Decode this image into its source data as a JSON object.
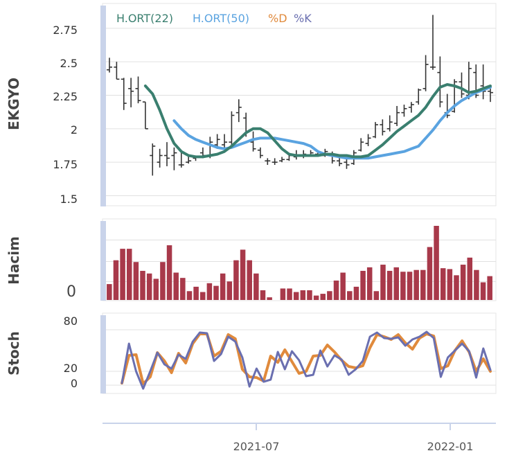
{
  "colors": {
    "ma22": "#3a7f6f",
    "ma50": "#5aa3e0",
    "stoch_d": "#e08a3c",
    "stoch_k": "#6a6fb0",
    "volume": "#a8394a",
    "ohlc": "#333333",
    "grid": "#e0e0e0",
    "scrollbar": "#c9d3ea"
  },
  "chart_data": [
    {
      "type": "ohlc",
      "ylabel": "EKGYO",
      "yticks": [
        "2.75",
        "2.5",
        "2.25",
        "2",
        "1.75",
        "1.5"
      ],
      "ylim": [
        1.43,
        2.92
      ],
      "x_ticks": [
        "2021-07",
        "2022-01"
      ],
      "legend": [
        "H.ORT(22)",
        "H.ORT(50)",
        "%D",
        "%K"
      ],
      "ohlc": [
        [
          2.44,
          2.53,
          2.42,
          2.46
        ],
        [
          2.46,
          2.5,
          2.37,
          2.37
        ],
        [
          2.37,
          2.38,
          2.14,
          2.19
        ],
        [
          2.3,
          2.38,
          2.16,
          2.28
        ],
        [
          2.3,
          2.39,
          2.19,
          2.21
        ],
        [
          2.2,
          2.2,
          2.0,
          2.0
        ],
        [
          1.8,
          1.89,
          1.65,
          1.87
        ],
        [
          1.75,
          1.85,
          1.71,
          1.8
        ],
        [
          1.8,
          1.9,
          1.72,
          1.78
        ],
        [
          1.8,
          1.86,
          1.69,
          1.82
        ],
        [
          1.73,
          1.82,
          1.71,
          1.73
        ],
        [
          1.75,
          1.8,
          1.74,
          1.76
        ],
        [
          1.78,
          1.8,
          1.76,
          1.79
        ],
        [
          1.82,
          1.86,
          1.78,
          1.8
        ],
        [
          1.8,
          1.94,
          1.78,
          1.9
        ],
        [
          1.88,
          1.96,
          1.85,
          1.92
        ],
        [
          1.88,
          1.96,
          1.85,
          1.9
        ],
        [
          1.9,
          2.13,
          1.88,
          2.1
        ],
        [
          2.12,
          2.22,
          2.05,
          2.16
        ],
        [
          2.08,
          2.12,
          1.94,
          1.98
        ],
        [
          1.9,
          1.98,
          1.83,
          1.85
        ],
        [
          1.84,
          1.86,
          1.78,
          1.8
        ],
        [
          1.76,
          1.78,
          1.73,
          1.76
        ],
        [
          1.75,
          1.78,
          1.73,
          1.75
        ],
        [
          1.76,
          1.79,
          1.75,
          1.77
        ],
        [
          1.77,
          1.82,
          1.76,
          1.8
        ],
        [
          1.79,
          1.84,
          1.77,
          1.8
        ],
        [
          1.8,
          1.84,
          1.78,
          1.81
        ],
        [
          1.8,
          1.84,
          1.79,
          1.82
        ],
        [
          1.81,
          1.84,
          1.79,
          1.8
        ],
        [
          1.8,
          1.85,
          1.79,
          1.83
        ],
        [
          1.81,
          1.83,
          1.74,
          1.76
        ],
        [
          1.76,
          1.79,
          1.72,
          1.74
        ],
        [
          1.75,
          1.78,
          1.7,
          1.73
        ],
        [
          1.74,
          1.84,
          1.73,
          1.82
        ],
        [
          1.84,
          1.93,
          1.83,
          1.9
        ],
        [
          1.89,
          1.96,
          1.87,
          1.93
        ],
        [
          1.94,
          2.05,
          1.93,
          2.03
        ],
        [
          2.03,
          2.07,
          1.95,
          1.98
        ],
        [
          2.0,
          2.1,
          1.98,
          2.05
        ],
        [
          2.04,
          2.17,
          2.02,
          2.12
        ],
        [
          2.12,
          2.18,
          2.09,
          2.15
        ],
        [
          2.16,
          2.2,
          2.12,
          2.18
        ],
        [
          2.2,
          2.3,
          2.18,
          2.29
        ],
        [
          2.3,
          2.55,
          2.28,
          2.48
        ],
        [
          2.46,
          2.85,
          2.44,
          2.46
        ],
        [
          2.42,
          2.54,
          2.16,
          2.2
        ],
        [
          2.12,
          2.26,
          2.08,
          2.1
        ],
        [
          2.13,
          2.37,
          2.12,
          2.35
        ],
        [
          2.35,
          2.42,
          2.23,
          2.26
        ],
        [
          2.25,
          2.5,
          2.22,
          2.45
        ],
        [
          2.42,
          2.48,
          2.23,
          2.25
        ],
        [
          2.32,
          2.48,
          2.22,
          2.28
        ],
        [
          2.28,
          2.3,
          2.2,
          2.27
        ]
      ],
      "ma22": [
        null,
        null,
        null,
        null,
        null,
        2.32,
        2.26,
        2.14,
        2.0,
        1.89,
        1.83,
        1.8,
        1.79,
        1.79,
        1.8,
        1.81,
        1.83,
        1.87,
        1.92,
        1.97,
        2.0,
        2.0,
        1.97,
        1.91,
        1.85,
        1.81,
        1.8,
        1.8,
        1.8,
        1.8,
        1.81,
        1.81,
        1.8,
        1.8,
        1.79,
        1.79,
        1.8,
        1.84,
        1.88,
        1.93,
        1.98,
        2.02,
        2.06,
        2.1,
        2.16,
        2.24,
        2.31,
        2.33,
        2.32,
        2.3,
        2.27,
        2.28,
        2.3,
        2.32
      ],
      "ma50": [
        null,
        null,
        null,
        null,
        null,
        null,
        null,
        null,
        null,
        2.06,
        2.0,
        1.95,
        1.92,
        1.9,
        1.88,
        1.86,
        1.85,
        1.86,
        1.88,
        1.9,
        1.92,
        1.93,
        1.93,
        1.93,
        1.92,
        1.91,
        1.9,
        1.89,
        1.87,
        1.83,
        1.81,
        1.8,
        1.79,
        1.78,
        1.78,
        1.78,
        1.78,
        1.79,
        1.8,
        1.81,
        1.82,
        1.83,
        1.85,
        1.87,
        1.93,
        1.99,
        2.06,
        2.12,
        2.17,
        2.21,
        2.24,
        2.27,
        2.29,
        2.31
      ]
    },
    {
      "type": "bar",
      "ylabel": "Hacim",
      "ytick": "0",
      "values": [
        18,
        45,
        58,
        58,
        43,
        33,
        30,
        24,
        43,
        62,
        31,
        25,
        10,
        15,
        9,
        19,
        16,
        30,
        21,
        45,
        57,
        45,
        30,
        11,
        3,
        0,
        13,
        13,
        9,
        11,
        11,
        5,
        7,
        10,
        22,
        31,
        10,
        15,
        33,
        37,
        10,
        40,
        33,
        37,
        32,
        32,
        34,
        34,
        60,
        84,
        36,
        35,
        28,
        40,
        48,
        34,
        20,
        27
      ]
    },
    {
      "type": "line",
      "ylabel": "Stoch",
      "yticks": [
        "80",
        "20",
        "0"
      ],
      "ylim": [
        -10,
        100
      ],
      "d": [
        3,
        43,
        44,
        2,
        12,
        47,
        35,
        18,
        46,
        32,
        60,
        74,
        74,
        42,
        49,
        73,
        67,
        23,
        12,
        11,
        6,
        42,
        33,
        51,
        34,
        17,
        20,
        42,
        43,
        58,
        48,
        36,
        27,
        25,
        28,
        54,
        73,
        70,
        66,
        73,
        61,
        52,
        68,
        74,
        71,
        24,
        28,
        50,
        64,
        48,
        20,
        38,
        20
      ],
      "k": [
        3,
        60,
        20,
        -5,
        20,
        47,
        30,
        24,
        44,
        38,
        63,
        76,
        75,
        35,
        45,
        70,
        63,
        40,
        -2,
        24,
        5,
        8,
        48,
        23,
        49,
        36,
        13,
        15,
        50,
        27,
        43,
        37,
        15,
        23,
        35,
        70,
        76,
        68,
        67,
        69,
        57,
        66,
        70,
        77,
        68,
        12,
        40,
        50,
        60,
        49,
        11,
        53,
        22
      ]
    }
  ]
}
